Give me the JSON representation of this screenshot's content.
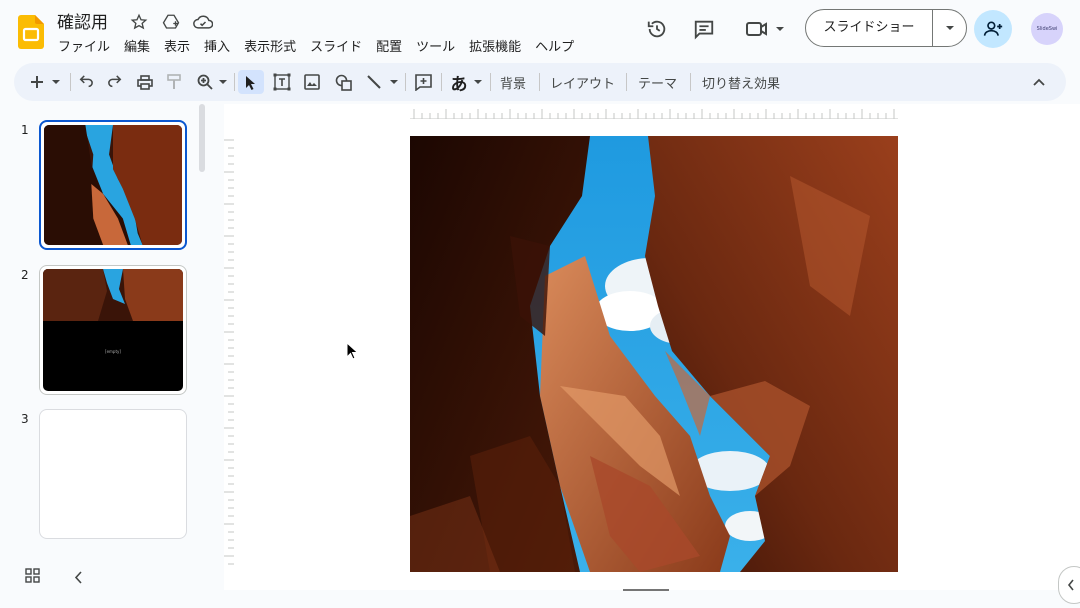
{
  "app": {
    "doc_title": "確認用"
  },
  "menu": [
    "ファイル",
    "編集",
    "表示",
    "挿入",
    "表示形式",
    "スライド",
    "配置",
    "ツール",
    "拡張機能",
    "ヘルプ"
  ],
  "header": {
    "slideshow_label": "スライドショー",
    "avatar_text": "SlideSwi"
  },
  "toolbar": {
    "input_tool_label": "あ",
    "background_label": "背景",
    "layout_label": "レイアウト",
    "theme_label": "テーマ",
    "transition_label": "切り替え効果"
  },
  "filmstrip": {
    "slides": [
      {
        "number": "1",
        "selected": true
      },
      {
        "number": "2",
        "caption": "[empty]"
      },
      {
        "number": "3"
      }
    ]
  },
  "colors": {
    "accent": "#0b57d0",
    "toolbar_bg": "#edf2fa",
    "share_bg": "#c2e7ff",
    "sky": "#29a4e0",
    "rock_dark": "#3a1408",
    "rock_mid": "#8a3a1a",
    "rock_light": "#c8683a"
  }
}
